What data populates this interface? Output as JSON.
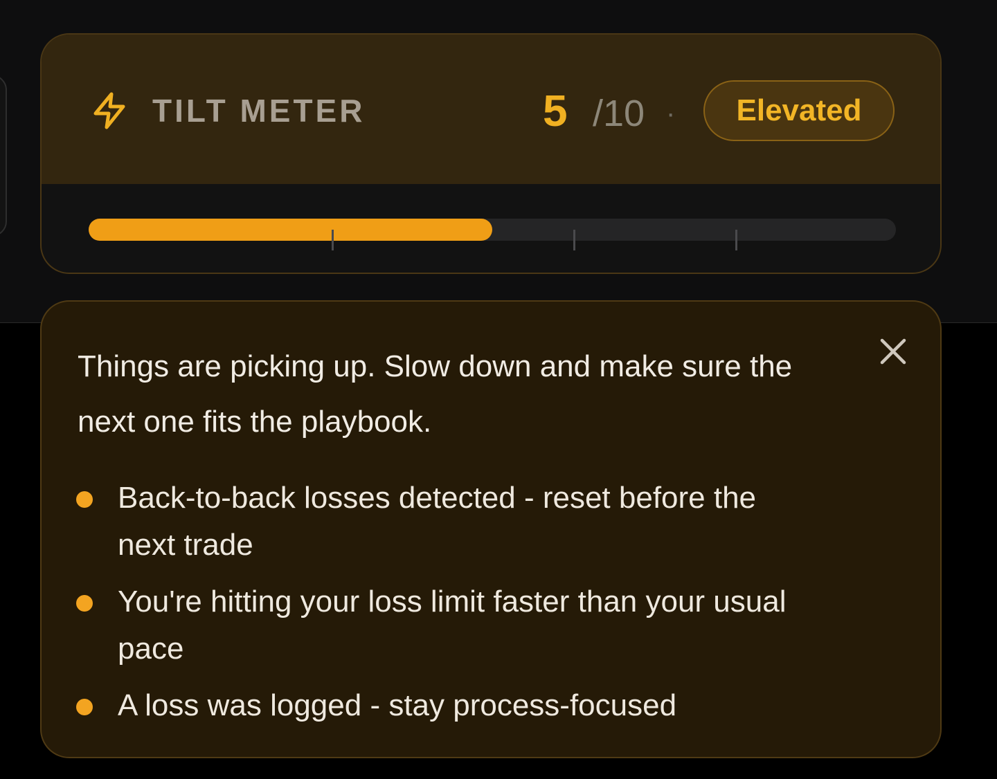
{
  "tilt_meter": {
    "title": "TILT METER",
    "score": "5",
    "score_max": "/10",
    "separator": "·",
    "status": "Elevated",
    "level_fraction": 0.5,
    "colors": {
      "accent": "#f0b022",
      "bar_fill": "#f09e16",
      "header_bg": "#33260f"
    },
    "icon": "lightning-bolt-icon"
  },
  "advice": {
    "message": "Things are picking up. Slow down and make sure the next one fits the playbook.",
    "reasons": [
      "Back-to-back losses detected - reset before the next trade",
      "You're hitting your loss limit faster than your usual pace",
      "A loss was logged - stay process-focused"
    ],
    "close_icon": "close-icon"
  }
}
